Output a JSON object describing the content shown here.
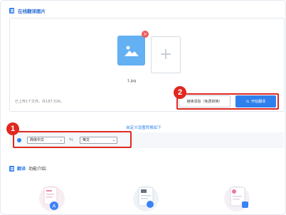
{
  "section_upload": {
    "title": "在线翻译图片"
  },
  "file": {
    "name": "1.jpg",
    "close_glyph": "×"
  },
  "upload": {
    "add_glyph": "+",
    "info": "已上传1个文件，共187.52K。"
  },
  "buttons": {
    "continue": "继续添加（免费转换）",
    "start": "开始翻译",
    "start_icon_glyph": "⇆"
  },
  "annotations": {
    "badge1": "1",
    "badge2": "2"
  },
  "translation": {
    "custom_link": "自定义设置转换如下",
    "source_lang": "简体中文",
    "target_lang": "英文",
    "select_arrow": "⌄",
    "swap_glyph": "⇆"
  },
  "features": {
    "title_prefix": "翻译",
    "title_suffix": "功能介绍:"
  },
  "colors": {
    "accent": "#2f80ed",
    "annotation": "#e0281f",
    "thumb": "#63b0f2"
  },
  "icons": [
    "document-icon",
    "image-file-icon",
    "close-icon",
    "plus-icon",
    "swap-icon",
    "chevron-down-icon"
  ]
}
